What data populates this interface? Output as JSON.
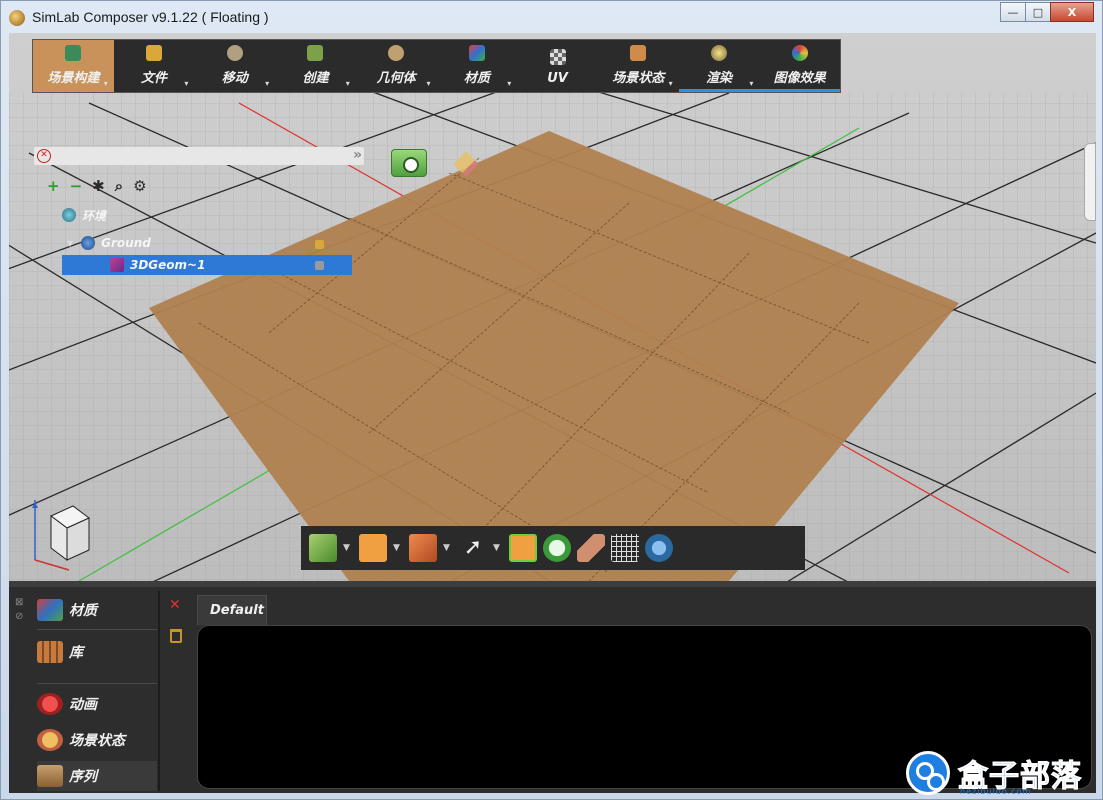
{
  "window": {
    "title": "SimLab Composer v9.1.22 ( Floating )",
    "buttons": {
      "minimize": "—",
      "maximize": "□",
      "close": "X"
    }
  },
  "toolbar": {
    "items": [
      {
        "label": "场景构建",
        "icon": "scene-build-icon",
        "active": true
      },
      {
        "label": "文件",
        "icon": "folder-icon"
      },
      {
        "label": "移动",
        "icon": "move-icon"
      },
      {
        "label": "创建",
        "icon": "create-box-icon"
      },
      {
        "label": "几何体",
        "icon": "geometry-icon"
      },
      {
        "label": "材质",
        "icon": "material-icon"
      },
      {
        "label": "UV",
        "icon": "uv-checker-icon"
      },
      {
        "label": "场景状态",
        "icon": "scene-state-icon"
      },
      {
        "label": "渲染",
        "icon": "render-icon"
      },
      {
        "label": "图像效果",
        "icon": "image-effects-icon"
      }
    ]
  },
  "scene_tree": {
    "search_placeholder": "",
    "nodes": [
      {
        "label": "环境",
        "level": 0
      },
      {
        "label": "Ground",
        "level": 1
      },
      {
        "label": "3DGeom~1",
        "level": 2,
        "selected": true
      }
    ]
  },
  "bottom_panel": {
    "nav": [
      {
        "label": "材质",
        "icon": "materials-icon"
      },
      {
        "label": "库",
        "icon": "library-icon"
      },
      {
        "label": "动画",
        "icon": "animation-icon"
      },
      {
        "label": "场景状态",
        "icon": "scene-states-icon"
      },
      {
        "label": "序列",
        "icon": "sequence-icon"
      }
    ],
    "tab": "Default"
  },
  "watermark": {
    "text": "盒子部落",
    "subtext": "hezibuluo.com"
  },
  "colors": {
    "accent": "#2f79d6",
    "active_tab": "#c8925a",
    "panel_bg": "#2d2d2d",
    "floor": "#b08150"
  }
}
